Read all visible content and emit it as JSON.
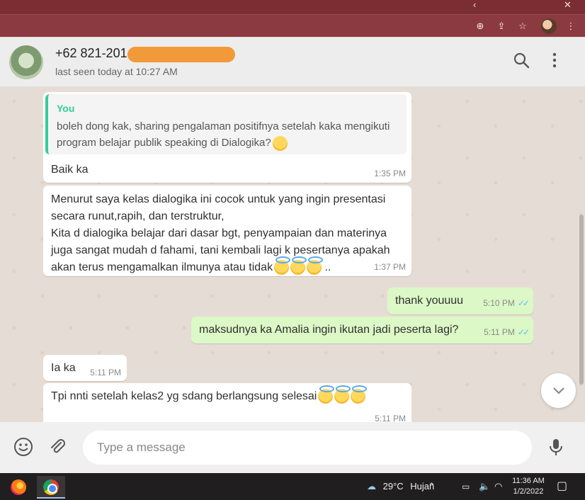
{
  "browser": {
    "controls": {
      "minimize": "‹",
      "close": "✕"
    },
    "toolbar_icons": [
      "zoom-icon",
      "share-icon",
      "bookmark-star-icon",
      "profile-avatar",
      "more-vert-icon"
    ]
  },
  "header": {
    "contact_name": "+62 821-201",
    "last_seen": "last seen today at 10:27 AM",
    "icons": [
      "search-icon",
      "menu-icon"
    ],
    "redaction_color": "#f29a3a"
  },
  "messages": [
    {
      "direction": "in",
      "quote": {
        "author": "You",
        "text": "boleh dong kak, sharing pengalaman positifnya setelah kaka mengikuti program belajar publik speaking di Dialogika?"
      },
      "text": "Baik ka",
      "time": "1:35 PM"
    },
    {
      "direction": "in",
      "text": "Menurut saya kelas dialogika ini cocok untuk yang ingin presentasi secara runut,rapih, dan terstruktur,\nKita d dialogika belajar dari dasar bgt, penyampaian dan materinya juga sangat mudah d fahami, tani kembali lagi k pesertanya apakah akan terus mengamalkan ilmunya atau tidak",
      "suffix": "..",
      "time": "1:37 PM"
    },
    {
      "direction": "out",
      "text": "thank youuuu",
      "time": "5:10 PM",
      "status": "read"
    },
    {
      "direction": "out",
      "text": "maksudnya ka Amalia ingin ikutan jadi peserta lagi?",
      "time": "5:11 PM",
      "status": "read"
    },
    {
      "direction": "in",
      "text": "Ia ka",
      "time": "5:11 PM"
    },
    {
      "direction": "in",
      "text": "Tpi nnti setelah kelas2 yg sdang berlangsung selesai",
      "time": "5:11 PM"
    }
  ],
  "composer": {
    "placeholder": "Type a message",
    "icons": [
      "emoji-icon",
      "attach-icon",
      "mic-icon"
    ]
  },
  "taskbar": {
    "weather": "29°C",
    "weather_text": "Hujan",
    "time": "11:36 AM",
    "date": "1/2/2022"
  },
  "colors": {
    "chrome": "#8a3a40",
    "outgoing_bubble": "#dcf8c6",
    "quote_accent": "#35cd96",
    "read_ticks": "#4fc3f7"
  }
}
